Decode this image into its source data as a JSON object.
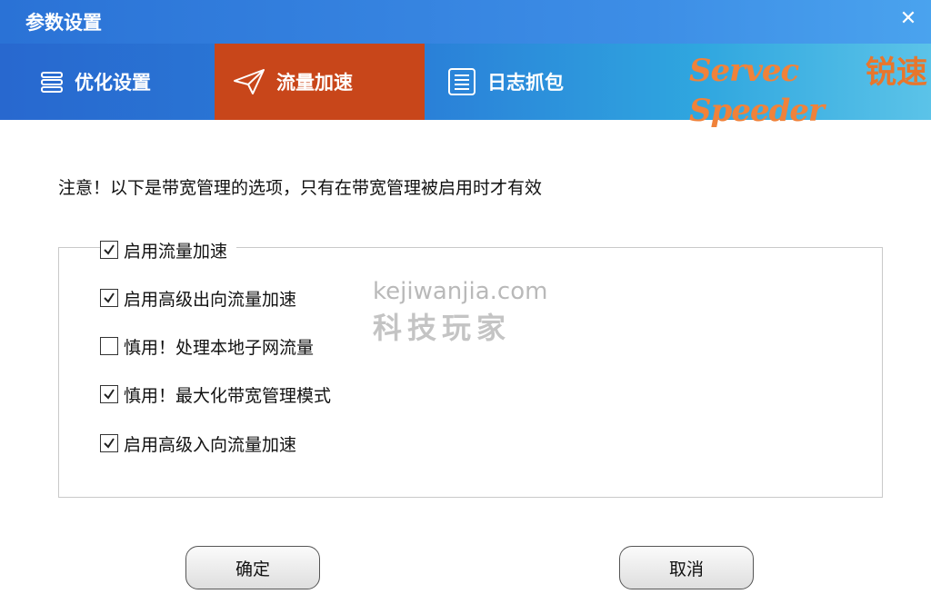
{
  "window": {
    "title": "参数设置",
    "close_icon": "close-icon"
  },
  "tabs": [
    {
      "label": "优化设置",
      "icon": "server-icon",
      "active": false
    },
    {
      "label": "流量加速",
      "icon": "paper-plane-icon",
      "active": true
    },
    {
      "label": "日志抓包",
      "icon": "log-list-icon",
      "active": false
    }
  ],
  "brand": {
    "script": "Servec Speeder",
    "cn": "锐速"
  },
  "notice": "注意！以下是带宽管理的选项，只有在带宽管理被启用时才有效",
  "options": [
    {
      "label": "启用流量加速",
      "checked": true
    },
    {
      "label": "启用高级出向流量加速",
      "checked": true
    },
    {
      "label": "慎用！处理本地子网流量",
      "checked": false
    },
    {
      "label": "慎用！最大化带宽管理模式",
      "checked": true
    },
    {
      "label": "启用高级入向流量加速",
      "checked": true
    }
  ],
  "buttons": {
    "ok": "确定",
    "cancel": "取消"
  },
  "watermark": {
    "domain": "kejiwanjia.com",
    "cn": "科技玩家"
  },
  "colors": {
    "active_tab": "#c8461a",
    "brand_orange": "#f0823a"
  }
}
